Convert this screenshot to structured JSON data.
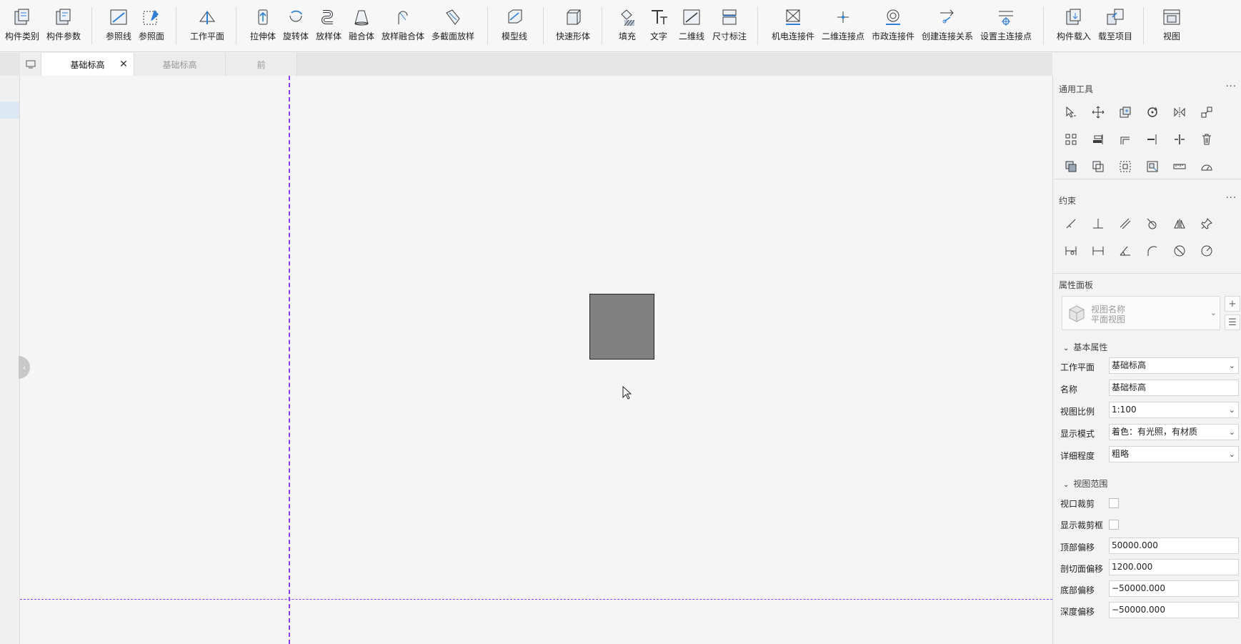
{
  "ribbon": {
    "tools": [
      {
        "name": "family-category",
        "label": "构件类别"
      },
      {
        "name": "family-params",
        "label": "构件参数"
      },
      {
        "name": "ref-line",
        "label": "参照线"
      },
      {
        "name": "ref-plane",
        "label": "参照面"
      },
      {
        "name": "work-plane",
        "label": "工作平面"
      },
      {
        "name": "extrusion",
        "label": "拉伸体"
      },
      {
        "name": "revolve",
        "label": "旋转体"
      },
      {
        "name": "sweep",
        "label": "放样体"
      },
      {
        "name": "blend",
        "label": "融合体"
      },
      {
        "name": "swept-blend",
        "label": "放样融合体"
      },
      {
        "name": "multi-section-sweep",
        "label": "多截面放样"
      },
      {
        "name": "model-line",
        "label": "模型线"
      },
      {
        "name": "quick-shape",
        "label": "快速形体"
      },
      {
        "name": "fill",
        "label": "填充"
      },
      {
        "name": "text",
        "label": "文字"
      },
      {
        "name": "line-2d",
        "label": "二维线"
      },
      {
        "name": "dimension",
        "label": "尺寸标注"
      },
      {
        "name": "mep-connector",
        "label": "机电连接件"
      },
      {
        "name": "connect-point-2d",
        "label": "二维连接点"
      },
      {
        "name": "civil-connector",
        "label": "市政连接件"
      },
      {
        "name": "create-connection",
        "label": "创建连接关系"
      },
      {
        "name": "set-main-connector",
        "label": "设置主连接点"
      },
      {
        "name": "load-family",
        "label": "构件载入"
      },
      {
        "name": "load-to-project",
        "label": "载至项目"
      },
      {
        "name": "view",
        "label": "视图"
      }
    ]
  },
  "tabs": [
    {
      "label": "基础标高",
      "active": true
    },
    {
      "label": "基础标高",
      "active": false
    },
    {
      "label": "前",
      "active": false
    }
  ],
  "panel": {
    "general_tools_title": "通用工具",
    "constraints_title": "约束",
    "properties_title": "属性面板",
    "more": "···",
    "view_selector": {
      "line1": "视图名称",
      "line2": "平面视图"
    },
    "basic_group": "基本属性",
    "range_group": "视图范围",
    "basic_props": [
      {
        "label": "工作平面",
        "value": "基础标高",
        "dropdown": true
      },
      {
        "label": "名称",
        "value": "基础标高",
        "dropdown": false
      },
      {
        "label": "视图比例",
        "value": "1:100",
        "dropdown": true
      },
      {
        "label": "显示模式",
        "value": "着色：有光照，有材质",
        "dropdown": true
      },
      {
        "label": "详细程度",
        "value": "粗略",
        "dropdown": true
      }
    ],
    "checks": [
      {
        "label": "视口裁剪",
        "checked": false
      },
      {
        "label": "显示裁剪框",
        "checked": false
      }
    ],
    "range_props": [
      {
        "label": "顶部偏移",
        "value": "50000.000"
      },
      {
        "label": "剖切面偏移",
        "value": "1200.000"
      },
      {
        "label": "底部偏移",
        "value": "−50000.000"
      },
      {
        "label": "深度偏移",
        "value": "−50000.000"
      }
    ]
  },
  "colors": {
    "ref_line": "#8a3cf0",
    "icon_blue": "#2f7fd6",
    "icon_dark": "#3a3a3a",
    "box_fill": "#808080"
  }
}
